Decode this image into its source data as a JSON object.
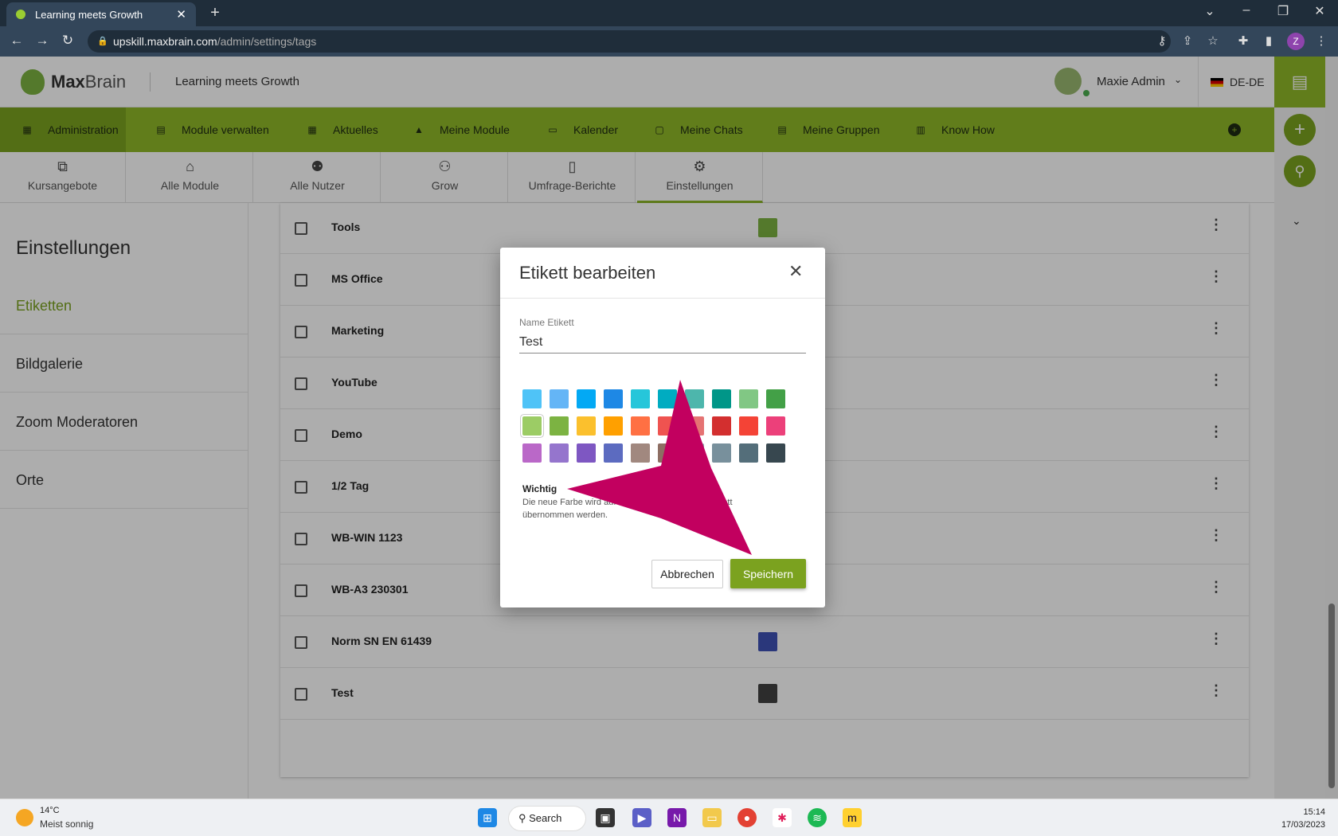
{
  "browser": {
    "tab_title": "Learning meets Growth",
    "url_host": "upskill.maxbrain.com",
    "url_path": "/admin/settings/tags",
    "profile_initial": "Z"
  },
  "header": {
    "logo_bold": "Max",
    "logo_light": "Brain",
    "tagline": "Learning meets Growth",
    "user_name": "Maxie Admin",
    "language": "DE-DE"
  },
  "topnav": [
    {
      "label": "Administration"
    },
    {
      "label": "Module verwalten"
    },
    {
      "label": "Aktuelles"
    },
    {
      "label": "Meine Module"
    },
    {
      "label": "Kalender"
    },
    {
      "label": "Meine Chats"
    },
    {
      "label": "Meine Gruppen"
    },
    {
      "label": "Know How"
    }
  ],
  "subnav": [
    {
      "label": "Kursangebote",
      "icon": "book-hand-icon"
    },
    {
      "label": "Alle Module",
      "icon": "bank-icon"
    },
    {
      "label": "Alle Nutzer",
      "icon": "users-icon"
    },
    {
      "label": "Grow",
      "icon": "group-icon"
    },
    {
      "label": "Umfrage-Berichte",
      "icon": "report-icon"
    },
    {
      "label": "Einstellungen",
      "icon": "gears-icon"
    }
  ],
  "sidebar": {
    "title": "Einstellungen",
    "items": [
      "Etiketten",
      "Bildgalerie",
      "Zoom Moderatoren",
      "Orte"
    ]
  },
  "tags": [
    {
      "name": "Tools",
      "color": "#7cb342"
    },
    {
      "name": "MS Office",
      "color": ""
    },
    {
      "name": "Marketing",
      "color": ""
    },
    {
      "name": "YouTube",
      "color": ""
    },
    {
      "name": "Demo",
      "color": ""
    },
    {
      "name": "1/2 Tag",
      "color": ""
    },
    {
      "name": "WB-WIN 1123",
      "color": ""
    },
    {
      "name": "WB-A3 230301",
      "color": ""
    },
    {
      "name": "Norm SN EN 61439",
      "color": "#3f51b5"
    },
    {
      "name": "Test",
      "color": "#424242"
    }
  ],
  "modal": {
    "title": "Etikett bearbeiten",
    "field_label": "Name Etikett",
    "field_value": "Test",
    "note_bold": "Wichtig",
    "note_text": "Die neue Farbe wird auf alle Inhalte mit diesem Etikett übernommen werden.",
    "cancel_label": "Abbrechen",
    "save_label": "Speichern",
    "palette": [
      "#4fc3f7",
      "#64b5f6",
      "#03a9f4",
      "#1e88e5",
      "#26c6da",
      "#00acc1",
      "#4db6ac",
      "#009688",
      "#81c784",
      "#43a047",
      "#9ccc65",
      "#7cb342",
      "#fbc02d",
      "#ffa000",
      "#ff7043",
      "#ef5350",
      "#e57373",
      "#d32f2f",
      "#f44336",
      "#ec407a",
      "#ba68c8",
      "#9575cd",
      "#7e57c2",
      "#5c6bc0",
      "#a1887f",
      "#8d6e63",
      "#90a4ae",
      "#78909c",
      "#546e7a",
      "#37474f"
    ],
    "selected_index": 10
  },
  "taskbar": {
    "weather_temp": "14°C",
    "weather_desc": "Meist sonnig",
    "search_label": "Search",
    "time": "15:14",
    "date": "17/03/2023"
  },
  "colors": {
    "accent": "#8fb829",
    "accent_dark": "#7ba21f",
    "annotation_arrow": "#c2005f"
  }
}
